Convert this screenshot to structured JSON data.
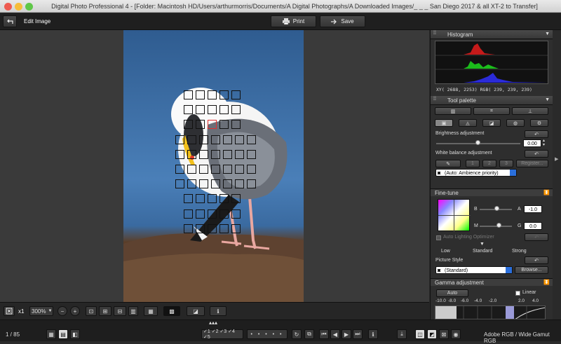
{
  "window": {
    "title": "Digital Photo Professional 4 - [Folder: Macintosh HD/Users/arthurmorris/Documents/A Digital Photographs/A Downloaded Images/_ _ _ San Diego 2017 & all XT-2 to Transfer]"
  },
  "toolbar": {
    "mode_label": "Edit Image",
    "print_label": "Print",
    "save_label": "Save"
  },
  "bottom_toolbar": {
    "zoom_multiplier": "x1",
    "zoom_level": "300%"
  },
  "status": {
    "page_count": "1 / 85",
    "color_space": "Adobe RGB / Wide Gamut RGB"
  },
  "panel": {
    "histogram": {
      "title": "Histogram",
      "xy_readout": "XY(  2688,  2253) RGB( 239,  239,  239)"
    },
    "tool_palette": {
      "title": "Tool palette",
      "brightness": {
        "label": "Brightness adjustment",
        "value": "0.00",
        "level": 0.5
      },
      "white_balance": {
        "label": "White balance adjustment",
        "preset1": "1",
        "preset2": "2",
        "preset3": "3",
        "register": "Register...",
        "mode": "(Auto: Ambience priority)"
      }
    },
    "fine_tune": {
      "title": "Fine-tune",
      "b_label": "B",
      "a_label": "A",
      "a_value": "-1.0",
      "m_label": "M",
      "g_label": "G",
      "g_value": "0.0",
      "b_level": 0.55,
      "m_level": 0.6,
      "alo_label": "Auto Lighting Optimizer",
      "alo_low": "Low",
      "alo_standard": "Standard",
      "alo_strong": "Strong"
    },
    "picture_style": {
      "label": "Picture Style",
      "value": "(Standard)",
      "browse": "Browse..."
    },
    "gamma": {
      "title": "Gamma adjustment",
      "auto": "Auto",
      "linear": "Linear",
      "ticks": [
        "-10.0",
        "-8.0",
        "-6.0",
        "-4.0",
        "-2.0",
        "2.0",
        "4.0"
      ]
    }
  },
  "colors": {
    "accent": "#2a6fdc",
    "af_selected": "#e03030",
    "panel_bg": "#2e2e2e"
  }
}
